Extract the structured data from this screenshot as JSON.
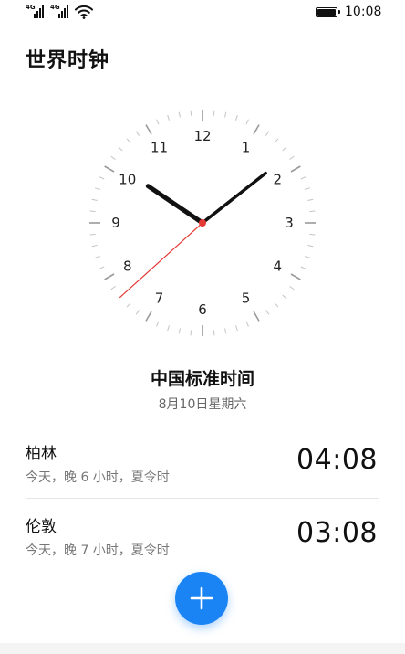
{
  "status_bar": {
    "signal1_label": "4G",
    "signal2_label": "4G",
    "time": "10:08",
    "icons": [
      "signal-icon",
      "signal-icon",
      "wifi-icon",
      "battery-icon"
    ]
  },
  "page": {
    "title": "世界时钟"
  },
  "clock": {
    "numbers": [
      "12",
      "1",
      "2",
      "3",
      "4",
      "5",
      "6",
      "7",
      "8",
      "9",
      "10",
      "11"
    ],
    "hour": 10,
    "minute": 8,
    "second": 38,
    "second_hand_color": "#e53935",
    "hand_color": "#111111"
  },
  "local": {
    "timezone": "中国标准时间",
    "date": "8月10日星期六"
  },
  "cities": [
    {
      "name": "柏林",
      "desc": "今天，晚 6 小时，夏令时",
      "time": "04:08"
    },
    {
      "name": "伦敦",
      "desc": "今天，晚 7 小时，夏令时",
      "time": "03:08"
    }
  ],
  "add_button": {
    "icon": "plus-icon",
    "color": "#1a84f5"
  }
}
